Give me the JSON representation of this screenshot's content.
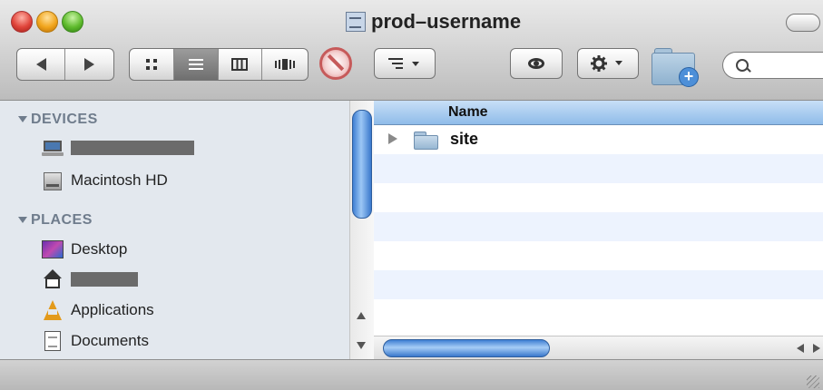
{
  "window": {
    "title": "prod–username"
  },
  "toolbar": {
    "nav_back": "back",
    "nav_forward": "forward",
    "view_modes": [
      "icon-view",
      "list-view",
      "column-view",
      "coverflow-view"
    ],
    "active_view": "list-view",
    "search_placeholder": ""
  },
  "sidebar": {
    "devices_header": "DEVICES",
    "places_header": "PLACES",
    "devices": [
      {
        "label": "",
        "icon": "laptop-icon",
        "redacted": true
      },
      {
        "label": "Macintosh HD",
        "icon": "hard-drive-icon"
      }
    ],
    "places": [
      {
        "label": "Desktop",
        "icon": "desktop-icon"
      },
      {
        "label": "",
        "icon": "home-icon",
        "redacted": true
      },
      {
        "label": "Applications",
        "icon": "applications-icon"
      },
      {
        "label": "Documents",
        "icon": "documents-icon"
      }
    ]
  },
  "list": {
    "column_name": "Name",
    "items": [
      {
        "name": "site",
        "kind": "folder"
      }
    ]
  },
  "colors": {
    "sidebar_bg": "#e3e8ee",
    "header_blue": "#8fbce9",
    "alt_row": "#edf3fe",
    "scroll_thumb": "#3f7fd3"
  }
}
